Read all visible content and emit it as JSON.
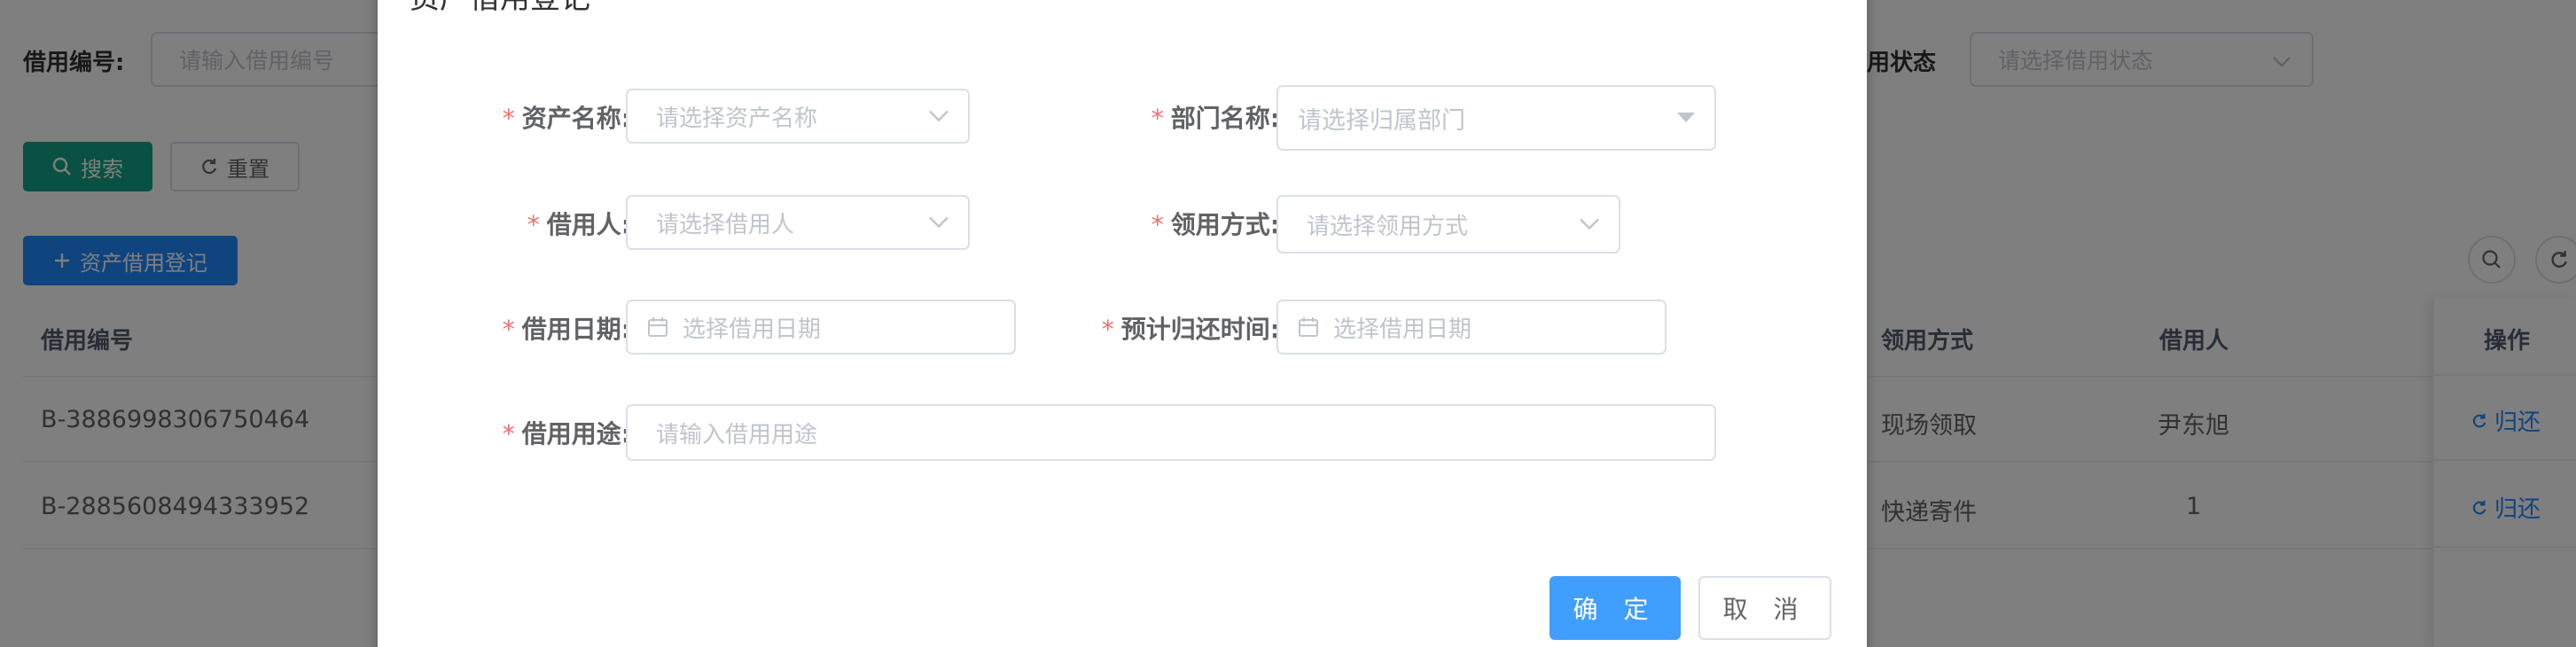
{
  "search": {
    "borrow_no_label": "借用编号:",
    "borrow_no_placeholder": "请输入借用编号",
    "status_label": "借用状态",
    "status_placeholder": "请选择借用状态",
    "search_btn": "搜索",
    "reset_btn": "重置"
  },
  "toolbar": {
    "add_btn": "资产借用登记"
  },
  "table": {
    "headers": {
      "borrow_no": "借用编号",
      "receive_method": "领用方式",
      "borrower": "借用人",
      "operation": "操作"
    },
    "rows": [
      {
        "borrow_no": "B-3886998306750464",
        "receive_method": "现场领取",
        "borrower": "尹东旭",
        "action": "归还"
      },
      {
        "borrow_no": "B-2885608494333952",
        "receive_method": "快递寄件",
        "borrower": "1",
        "action": "归还"
      }
    ]
  },
  "dialog": {
    "title": "资产借用登记",
    "fields": {
      "asset_name": {
        "label": "资产名称:",
        "placeholder": "请选择资产名称"
      },
      "department": {
        "label": "部门名称:",
        "placeholder": "请选择归属部门"
      },
      "borrower": {
        "label": "借用人:",
        "placeholder": "请选择借用人"
      },
      "receive_method": {
        "label": "领用方式:",
        "placeholder": "请选择领用方式"
      },
      "borrow_date": {
        "label": "借用日期:",
        "placeholder": "选择借用日期"
      },
      "return_date": {
        "label": "预计归还时间:",
        "placeholder": "选择借用日期"
      },
      "purpose": {
        "label": "借用用途:",
        "placeholder": "请输入借用用途"
      }
    },
    "required_mark": "*",
    "confirm_btn": "确 定",
    "cancel_btn": "取 消"
  },
  "colors": {
    "primary": "#409eff",
    "search_green": "#13a287",
    "required": "#f56c6c",
    "overlay": "rgba(0,0,0,0.5)"
  },
  "icons": [
    "search-icon",
    "refresh-icon",
    "plus-icon",
    "chevron-down-icon",
    "caret-down-icon",
    "calendar-icon"
  ]
}
